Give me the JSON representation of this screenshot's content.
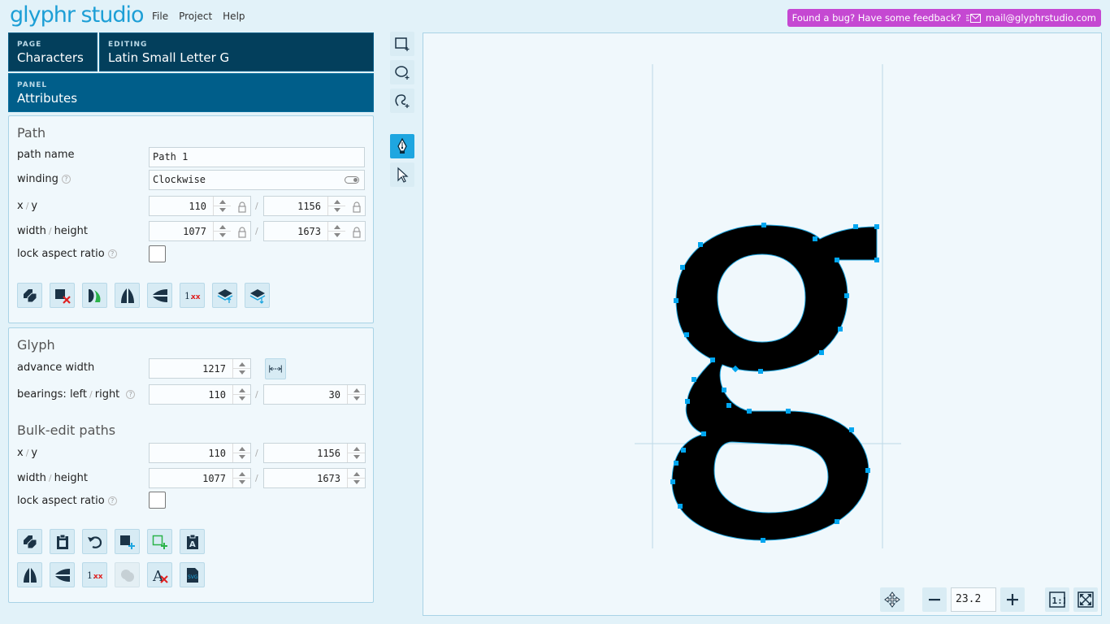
{
  "app": {
    "logo": "glyphr studio"
  },
  "menu": {
    "file": "File",
    "project": "Project",
    "help": "Help"
  },
  "feedback": {
    "text": "Found a bug? Have some feedback?",
    "email": "mail@glyphrstudio.com",
    "color": "#c548d2"
  },
  "nav": {
    "page_label": "PAGE",
    "page_value": "Characters",
    "editing_label": "EDITING",
    "editing_value": "Latin Small Letter G",
    "panel_label": "PANEL",
    "panel_value": "Attributes"
  },
  "path_card": {
    "title": "Path",
    "path_name_label": "path name",
    "path_name_value": "Path 1",
    "winding_label": "winding",
    "winding_value": "Clockwise",
    "x_label": "x",
    "y_label": "y",
    "slash": "/",
    "x_value": "110",
    "y_value": "1156",
    "width_label": "width",
    "height_label": "height",
    "width_value": "1077",
    "height_value": "1673",
    "lock_aspect_label": "lock aspect ratio",
    "help_glyph": "?"
  },
  "glyph_card": {
    "title": "Glyph",
    "advance_width_label": "advance width",
    "advance_width_value": "1217",
    "bearings_label": "bearings: left",
    "bearings_right_label": "right",
    "bearing_left_value": "110",
    "bearing_right_value": "30",
    "bulk_title": "Bulk-edit paths",
    "x_value": "110",
    "y_value": "1156",
    "width_value": "1077",
    "height_value": "1673",
    "lock_aspect_label": "lock aspect ratio"
  },
  "zoom": {
    "value": "23.2"
  },
  "colors": {
    "accent": "#1ea6e0",
    "dark_tile": "#033f5c",
    "panel_tile": "#005e8a",
    "handle": "#00a6f0"
  }
}
